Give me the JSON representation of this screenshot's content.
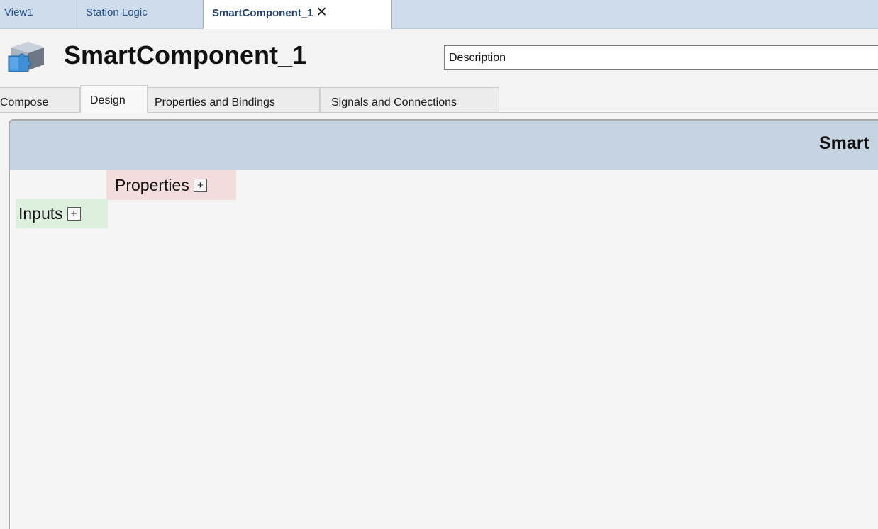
{
  "document_tabs": [
    {
      "label": "View1"
    },
    {
      "label": "Station Logic"
    },
    {
      "label": "SmartComponent_1",
      "active": true,
      "close_glyph": "✕"
    }
  ],
  "header": {
    "icon": "smart-component-puzzle-icon",
    "title": "SmartComponent_1",
    "description_value": "Description"
  },
  "editor_tabs": [
    {
      "label": "Compose"
    },
    {
      "label": "Design",
      "active": true
    },
    {
      "label": "Properties and Bindings"
    },
    {
      "label": "Signals and Connections"
    }
  ],
  "canvas": {
    "title": "Smart",
    "properties_label": "Properties",
    "inputs_label": "Inputs",
    "add_glyph": "+"
  },
  "colors": {
    "tab_strip": "#cfdcec",
    "canvas_header": "#c6d3e1",
    "properties_block": "#f2dcdc",
    "inputs_block": "#ddefdd"
  }
}
